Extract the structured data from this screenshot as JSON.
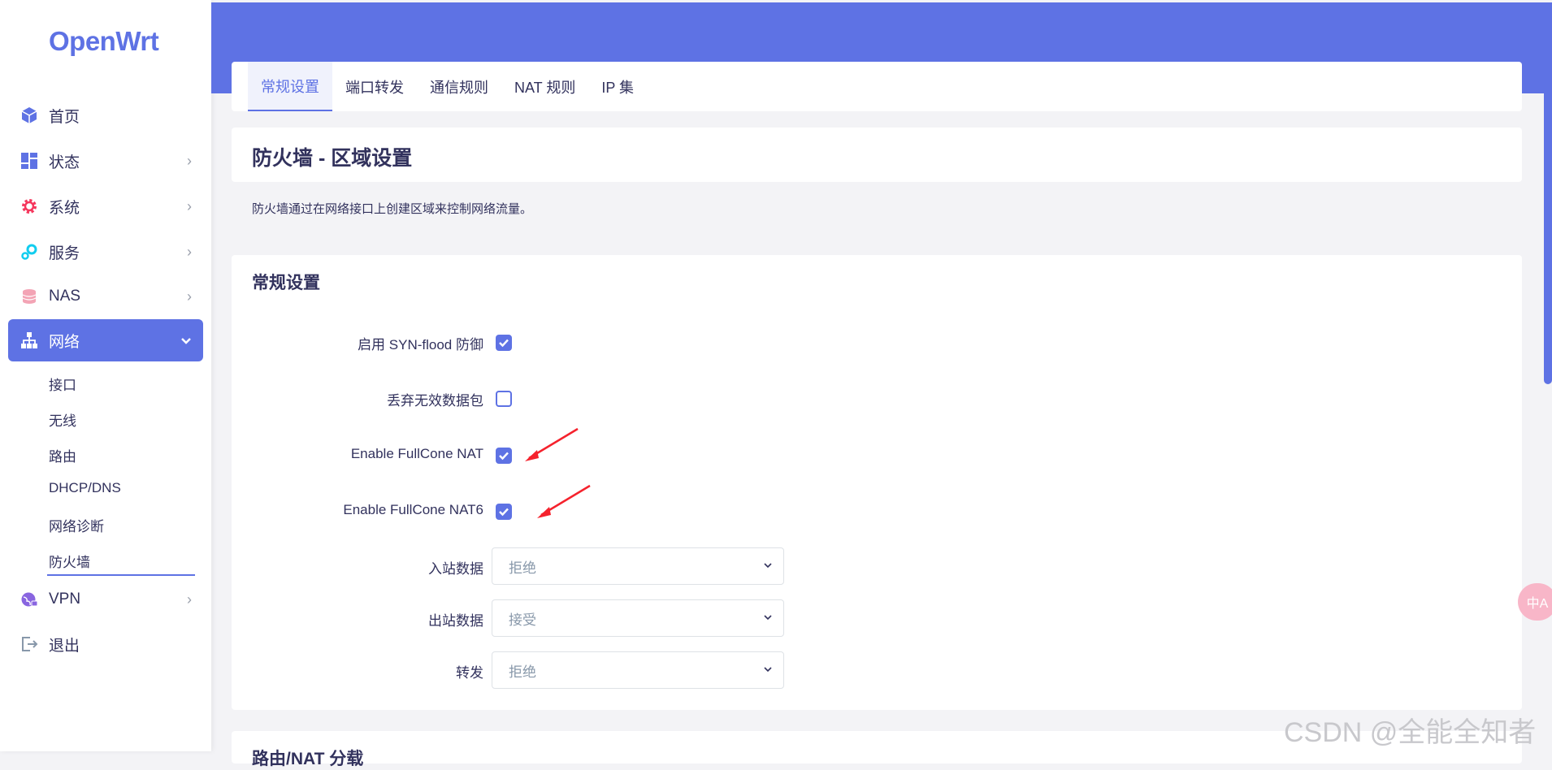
{
  "app": {
    "logo": "OpenWrt"
  },
  "sidebar": {
    "items": [
      {
        "label": "首页",
        "icon": "cube-icon",
        "color": "#5e72e4"
      },
      {
        "label": "状态",
        "icon": "dashboard-icon",
        "color": "#5e72e4"
      },
      {
        "label": "系统",
        "icon": "gear-icon",
        "color": "#f5365c"
      },
      {
        "label": "服务",
        "icon": "services-icon",
        "color": "#11cdef"
      },
      {
        "label": "NAS",
        "icon": "database-icon",
        "color": "#f3a4b5"
      },
      {
        "label": "网络",
        "icon": "network-icon",
        "color": "#ffffff"
      },
      {
        "label": "VPN",
        "icon": "globe-lock-icon",
        "color": "#8965e0"
      },
      {
        "label": "退出",
        "icon": "logout-icon",
        "color": "#8898aa"
      }
    ],
    "network_sub": [
      "接口",
      "无线",
      "路由",
      "DHCP/DNS",
      "网络诊断",
      "防火墙"
    ]
  },
  "tabs": [
    "常规设置",
    "端口转发",
    "通信规则",
    "NAT 规则",
    "IP 集"
  ],
  "page": {
    "title": "防火墙 - 区域设置",
    "description": "防火墙通过在网络接口上创建区域来控制网络流量。"
  },
  "general": {
    "title": "常规设置",
    "syn_flood": {
      "label": "启用 SYN-flood 防御",
      "checked": true
    },
    "drop_invalid": {
      "label": "丢弃无效数据包",
      "checked": false
    },
    "fullcone": {
      "label": "Enable FullCone NAT",
      "checked": true
    },
    "fullcone6": {
      "label": "Enable FullCone NAT6",
      "checked": true
    },
    "input": {
      "label": "入站数据",
      "value": "拒绝"
    },
    "output": {
      "label": "出站数据",
      "value": "接受"
    },
    "forward": {
      "label": "转发",
      "value": "拒绝"
    }
  },
  "next_section": {
    "title": "路由/NAT 分载"
  },
  "watermark": "CSDN @全能全知者",
  "translate_bubble": "中A",
  "colors": {
    "accent": "#5e72e4",
    "annotation_arrow": "#f5222d"
  }
}
